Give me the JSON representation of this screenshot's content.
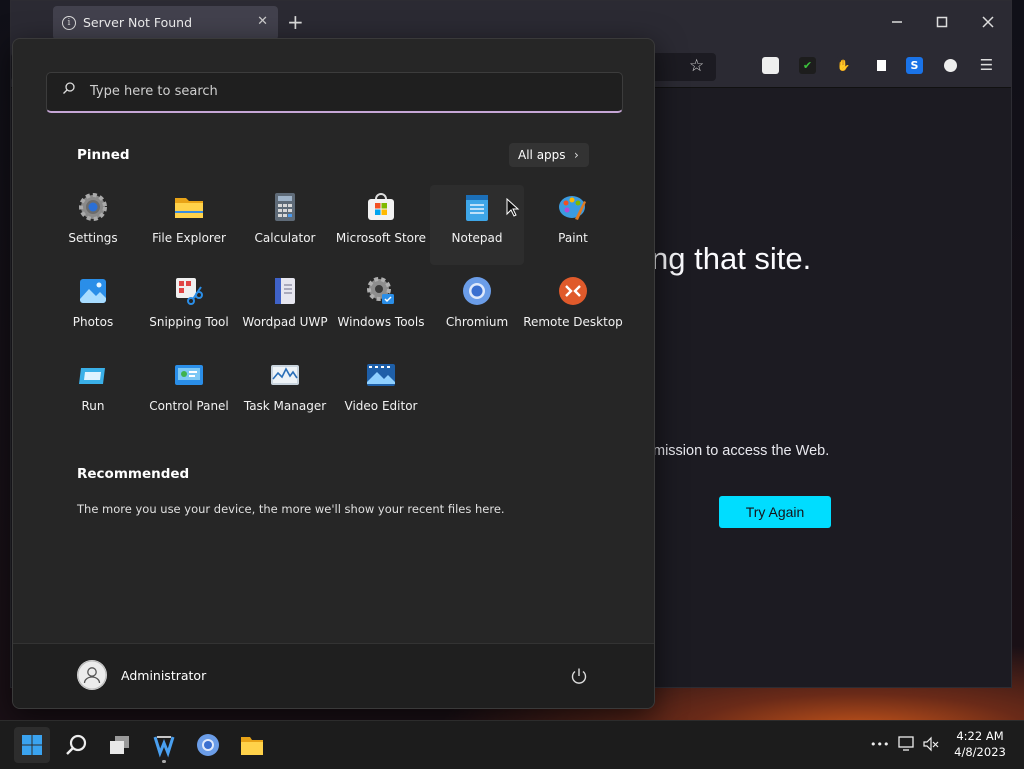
{
  "browser": {
    "tab_title": "Server Not Found",
    "tab_close": "✕",
    "new_tab": "+",
    "page_heading": "ng that site.",
    "page_text": "mission to access the Web.",
    "try_again": "Try Again"
  },
  "start_menu": {
    "search_placeholder": "Type here to search",
    "pinned_label": "Pinned",
    "all_apps": "All apps",
    "apps": [
      {
        "label": "Settings",
        "icon": "settings-icon"
      },
      {
        "label": "File Explorer",
        "icon": "folder-icon"
      },
      {
        "label": "Calculator",
        "icon": "calculator-icon"
      },
      {
        "label": "Microsoft Store",
        "icon": "store-icon"
      },
      {
        "label": "Notepad",
        "icon": "notepad-icon"
      },
      {
        "label": "Paint",
        "icon": "paint-palette-icon"
      },
      {
        "label": "Photos",
        "icon": "photos-icon"
      },
      {
        "label": "Snipping Tool",
        "icon": "scissors-icon"
      },
      {
        "label": "Wordpad UWP",
        "icon": "wordpad-icon"
      },
      {
        "label": "Windows Tools",
        "icon": "tools-gear-icon"
      },
      {
        "label": "Chromium",
        "icon": "chromium-icon"
      },
      {
        "label": "Remote Desktop",
        "icon": "remote-desktop-icon"
      },
      {
        "label": "Run",
        "icon": "run-icon"
      },
      {
        "label": "Control Panel",
        "icon": "control-panel-icon"
      },
      {
        "label": "Task Manager",
        "icon": "task-manager-icon"
      },
      {
        "label": "Video Editor",
        "icon": "video-editor-icon"
      }
    ],
    "recommended_label": "Recommended",
    "recommended_text": "The more you use your device, the more we'll show your recent files here.",
    "user_name": "Administrator"
  },
  "taskbar": {
    "time": "4:22 AM",
    "date": "4/8/2023",
    "overflow": "•••"
  },
  "colors": {
    "accent": "#00ddff",
    "start_bg": "#262626",
    "taskbar_bg": "#1c1c1c"
  }
}
